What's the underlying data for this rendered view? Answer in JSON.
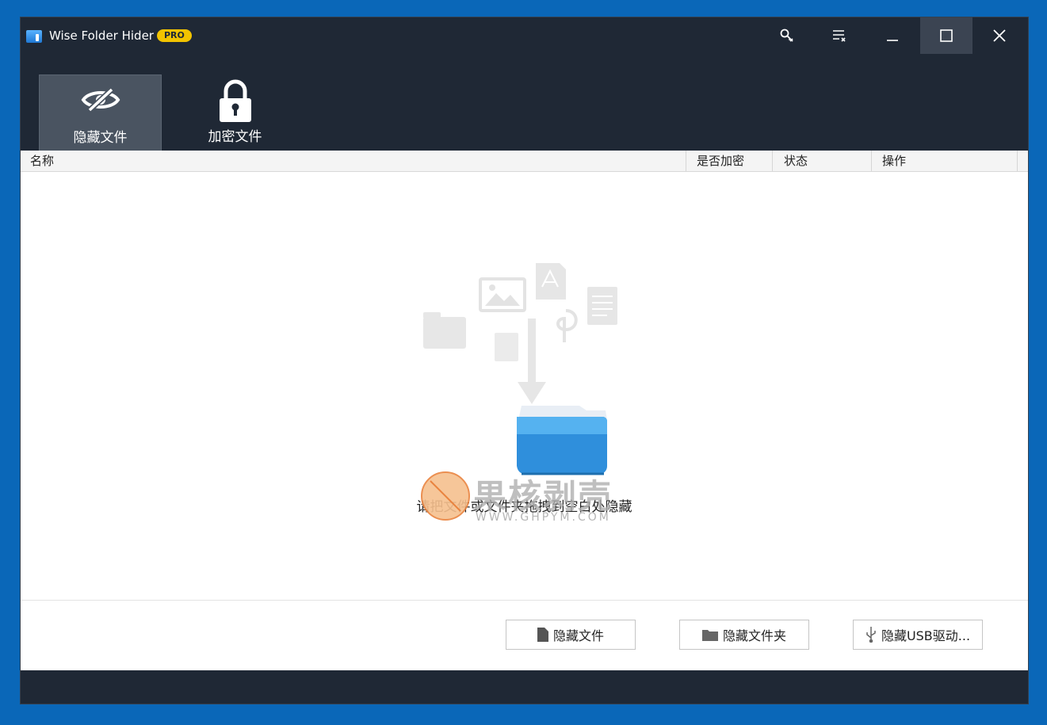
{
  "window": {
    "app_title": "Wise Folder Hider",
    "badge": "PRO",
    "controls": [
      "key-icon",
      "menu-icon",
      "minimize-icon",
      "maximize-icon",
      "close-icon"
    ]
  },
  "tabs": [
    {
      "label": "隐藏文件",
      "icon": "eye-slash-icon",
      "active": true
    },
    {
      "label": "加密文件",
      "icon": "lock-icon",
      "active": false
    }
  ],
  "table": {
    "columns": [
      "名称",
      "是否加密",
      "状态",
      "操作"
    ]
  },
  "drop_hint": "请把文件或文件夹拖拽到空白处隐藏",
  "watermark": {
    "title": "果核剥壳",
    "url": "WWW.GHPYM.COM"
  },
  "actions": [
    {
      "label": "隐藏文件",
      "icon": "file-icon"
    },
    {
      "label": "隐藏文件夹",
      "icon": "folder-icon"
    },
    {
      "label": "隐藏USB驱动...",
      "icon": "usb-icon"
    }
  ],
  "colors": {
    "desktop": "#0a67b8",
    "window": "#1f2835",
    "active_tab": "#4a5461",
    "badge": "#f2c300",
    "folder": "#2f8fdc"
  }
}
